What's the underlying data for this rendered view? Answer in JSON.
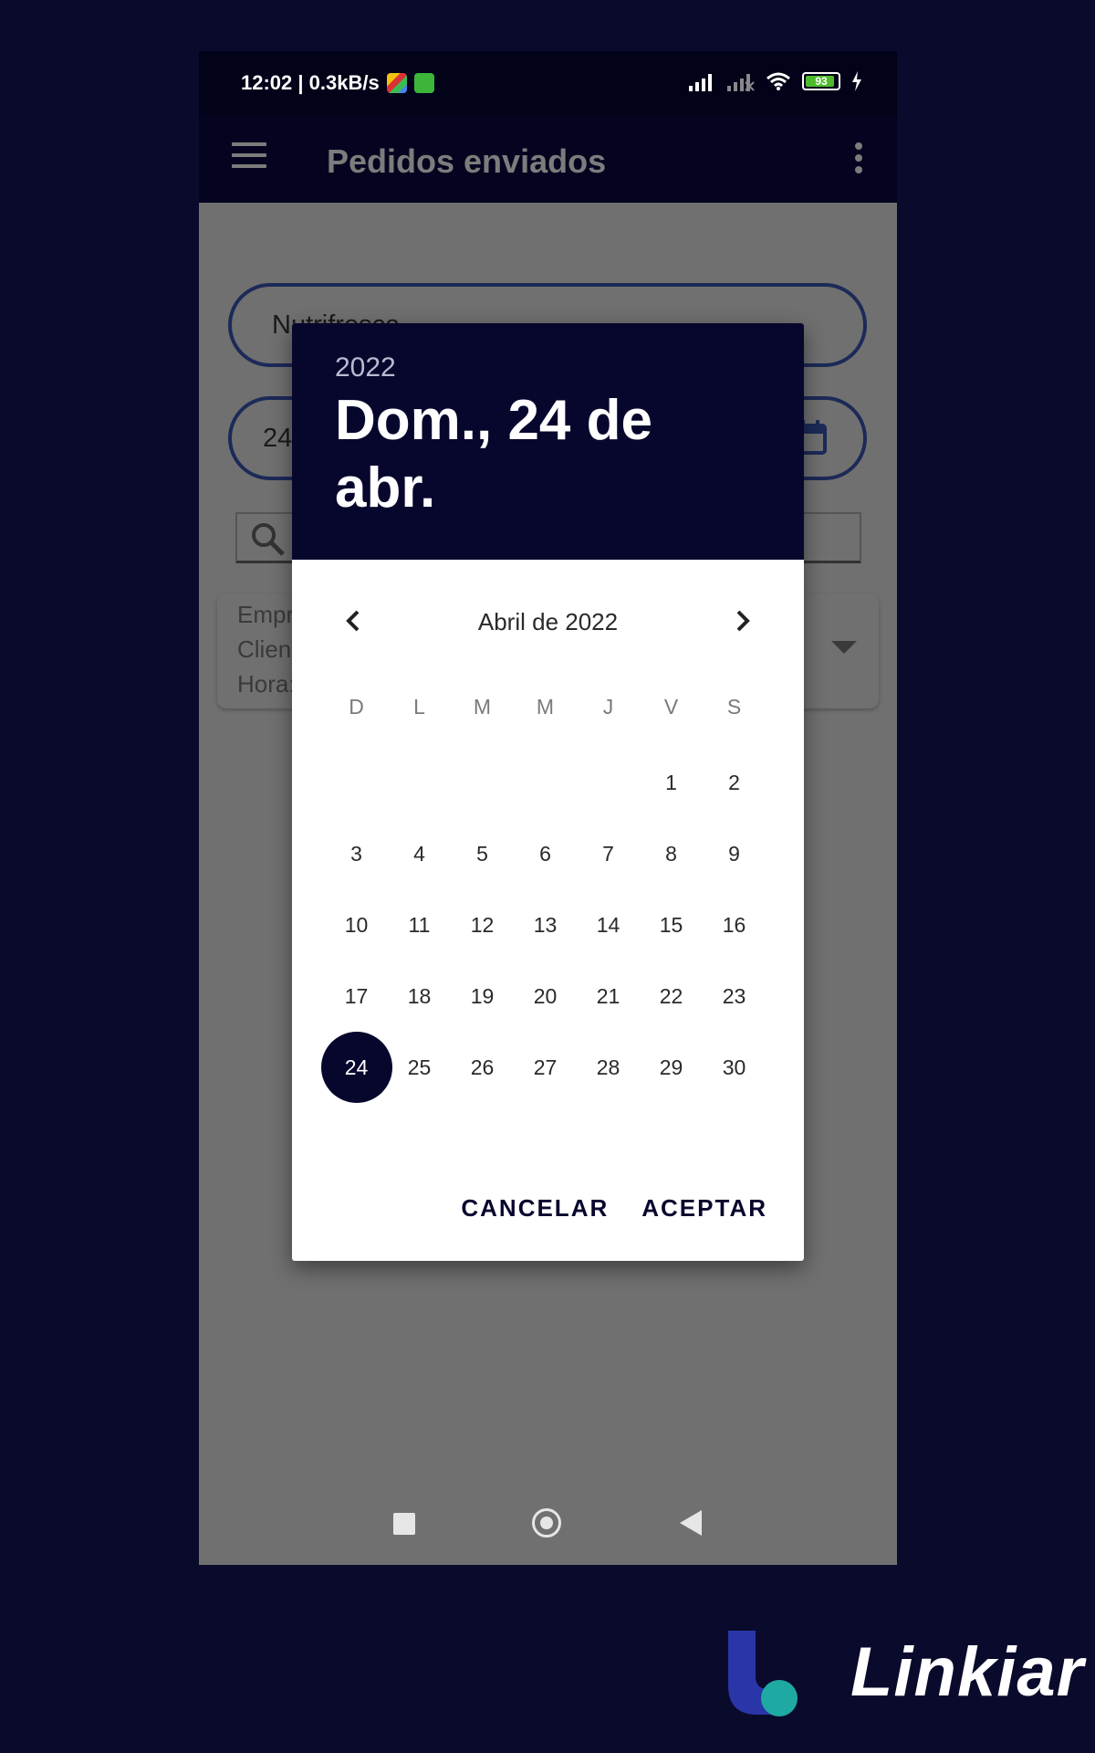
{
  "status_bar": {
    "time_speed": "12:02 | 0.3kB/s",
    "battery": "93",
    "battery_level": 0.93
  },
  "app_bar": {
    "title": "Pedidos enviados"
  },
  "content": {
    "supplier_value": "Nutrifresca",
    "date_value_partial": "24",
    "order_card_lines": [
      "Empr",
      "Clien",
      "Hora:"
    ]
  },
  "date_picker": {
    "year": "2022",
    "selected_date": "Dom., 24 de abr.",
    "month_label": "Abril de 2022",
    "weekdays": [
      "D",
      "L",
      "M",
      "M",
      "J",
      "V",
      "S"
    ],
    "leading_blanks": 5,
    "days": [
      "1",
      "2",
      "3",
      "4",
      "5",
      "6",
      "7",
      "8",
      "9",
      "10",
      "11",
      "12",
      "13",
      "14",
      "15",
      "16",
      "17",
      "18",
      "19",
      "20",
      "21",
      "22",
      "23",
      "24",
      "25",
      "26",
      "27",
      "28",
      "29",
      "30"
    ],
    "selected_day": "24",
    "cancel_label": "CANCELAR",
    "accept_label": "ACEPTAR"
  },
  "brand": {
    "name": "Linkiar"
  },
  "colors": {
    "background": "#0a0a2c",
    "accent": "#07072e",
    "overlay": "#707070",
    "logo_blue": "#2a36a8",
    "logo_teal": "#1fa9a3"
  },
  "icons": {
    "menu": "hamburger-icon",
    "overflow": "more-vert-icon",
    "calendar": "calendar-icon",
    "search": "search-icon",
    "prev": "chevron-left-icon",
    "next": "chevron-right-icon"
  }
}
